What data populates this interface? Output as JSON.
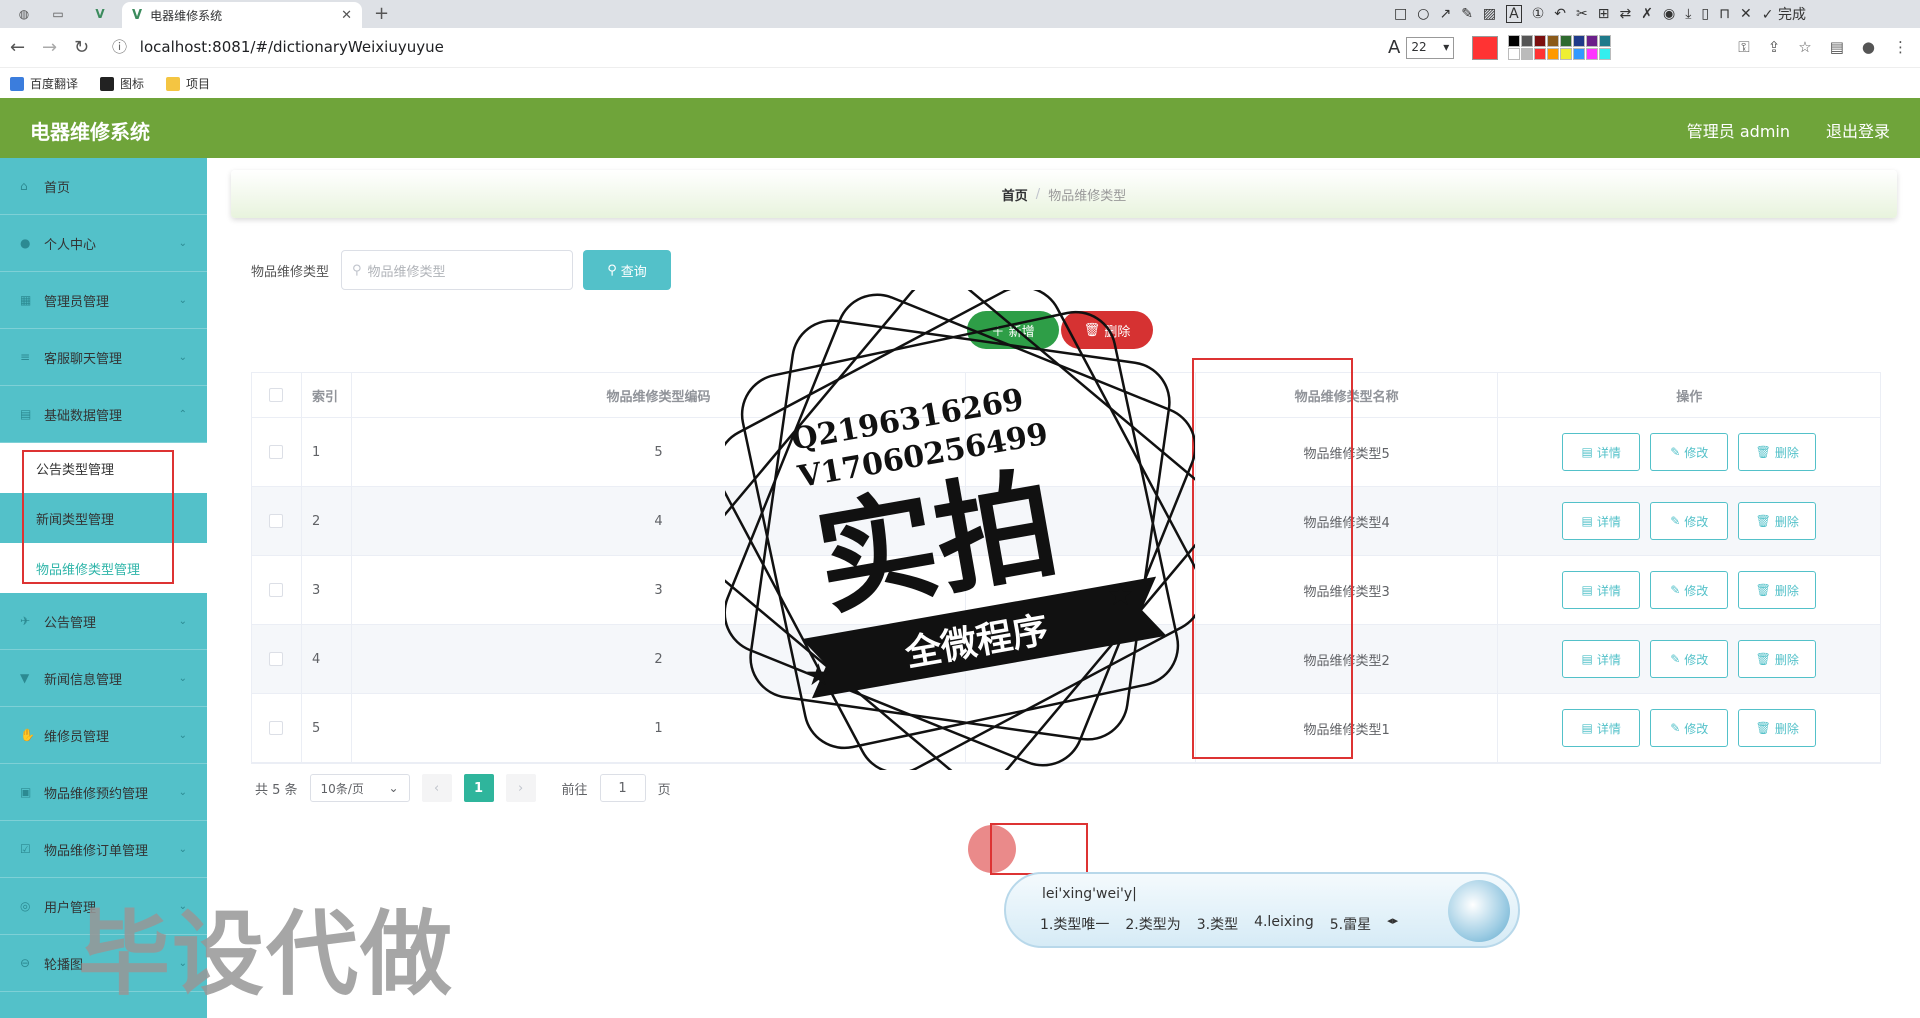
{
  "browser": {
    "tab_title": "电器维修系统",
    "url": "localhost:8081/#/dictionaryWeixiuyuyue",
    "font_size": "22",
    "done_label": "完成",
    "bookmarks": [
      "百度翻译",
      "图标",
      "项目"
    ]
  },
  "header": {
    "app_title": "电器维修系统",
    "user_info": "管理员 admin",
    "logout": "退出登录"
  },
  "sidebar": {
    "items_top": [
      "首页",
      "个人中心",
      "管理员管理",
      "客服聊天管理",
      "基础数据管理"
    ],
    "sub_items": [
      "公告类型管理",
      "新闻类型管理",
      "物品维修类型管理"
    ],
    "items_bottom": [
      "公告管理",
      "新闻信息管理",
      "维修员管理",
      "物品维修预约管理",
      "物品维修订单管理",
      "用户管理",
      "轮播图"
    ]
  },
  "breadcrumb": {
    "home": "首页",
    "sep": "/",
    "current": "物品维修类型"
  },
  "search": {
    "label": "物品维修类型",
    "placeholder": "物品维修类型",
    "button": "查询"
  },
  "actions": {
    "add": "新增",
    "delete": "删除"
  },
  "table": {
    "headers": {
      "index": "索引",
      "code": "物品维修类型编码",
      "name": "物品维修类型名称",
      "ops": "操作"
    },
    "rows": [
      {
        "index": "1",
        "code": "5",
        "name": "物品维修类型5"
      },
      {
        "index": "2",
        "code": "4",
        "name": "物品维修类型4"
      },
      {
        "index": "3",
        "code": "3",
        "name": "物品维修类型3"
      },
      {
        "index": "4",
        "code": "2",
        "name": "物品维修类型2"
      },
      {
        "index": "5",
        "code": "1",
        "name": "物品维修类型1"
      }
    ],
    "op_labels": {
      "detail": "详情",
      "edit": "修改",
      "delete": "删除"
    }
  },
  "pager": {
    "total": "共 5 条",
    "page_size": "10条/页",
    "current": "1",
    "goto_label": "前往",
    "goto_value": "1",
    "page_unit": "页"
  },
  "stamp": {
    "qq": "Q2196316269",
    "vx": "V17060256499",
    "big": "实拍",
    "banner": "全微程序"
  },
  "ime": {
    "composition": "lei'xing'wei'y|",
    "candidates": [
      "1.类型唯一",
      "2.类型为",
      "3.类型",
      "4.leixing",
      "5.雷星"
    ]
  },
  "watermark": "毕设代做",
  "colors": {
    "header": "#6fa43a",
    "sidebar": "#53c1c9",
    "accent": "#2fb59c",
    "danger": "#d63232",
    "success": "#2e9e47"
  }
}
